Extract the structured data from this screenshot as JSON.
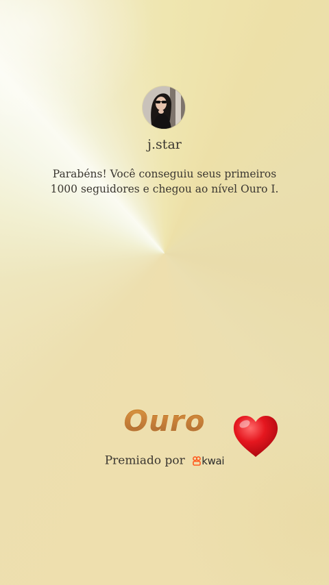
{
  "profile": {
    "username": "j.star",
    "avatar_alt": "profile photo"
  },
  "message": "Parabéns! Você conseguiu seus primeiros 1000 seguidores e chegou ao nível Ouro I.",
  "level": {
    "name": "Ouro"
  },
  "awarded": {
    "text": "Premiado por",
    "brand": "kwai",
    "brand_color": "#ff5a1f"
  },
  "sticker": {
    "icon": "heart-icon",
    "color": "#e5171f"
  },
  "colors": {
    "text": "#3a3630",
    "gold_top": "#d28a2a",
    "gold_bottom": "#8f4610"
  }
}
